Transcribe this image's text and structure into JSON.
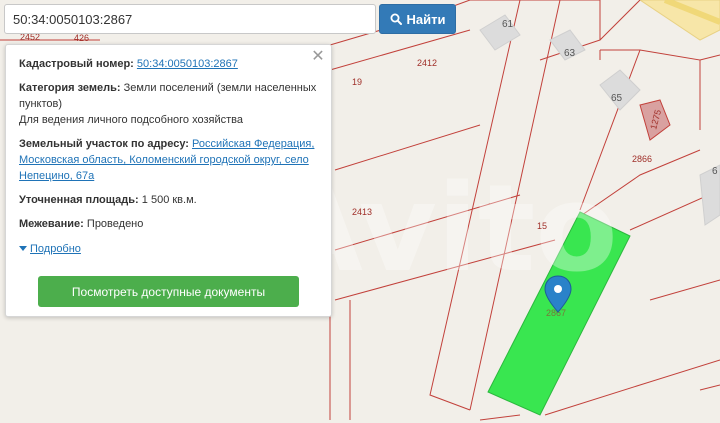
{
  "search": {
    "query": "50:34:0050103:2867",
    "button_label": "Найти"
  },
  "popup": {
    "cadastral_label": "Кадастровый номер:",
    "cadastral_value": "50:34:0050103:2867",
    "category_label": "Категория земель:",
    "category_value": "Земли поселений (земли населенных пунктов)",
    "purpose": "Для ведения личного подсобного хозяйства",
    "address_label": "Земельный участок по адресу:",
    "address_value": "Российская Федерация, Московская область, Коломенский городской округ, село Непецино, 67а",
    "area_label": "Уточненная площадь:",
    "area_value": "1 500 кв.м.",
    "survey_label": "Межевание:",
    "survey_value": "Проведено",
    "more_link": "Подробно",
    "docs_button": "Посмотреть доступные документы"
  },
  "map": {
    "parcel_labels": [
      "2452",
      "426",
      "19",
      "2412",
      "2413",
      "15",
      "2866",
      "2867",
      "1275"
    ],
    "house_labels": [
      "61",
      "63",
      "65",
      "6"
    ],
    "watermark": "Avito",
    "colors": {
      "background": "#f2efe9",
      "boundary": "#c2413b",
      "selected_parcel": "#39e650",
      "marker": "#2a82c9"
    }
  }
}
